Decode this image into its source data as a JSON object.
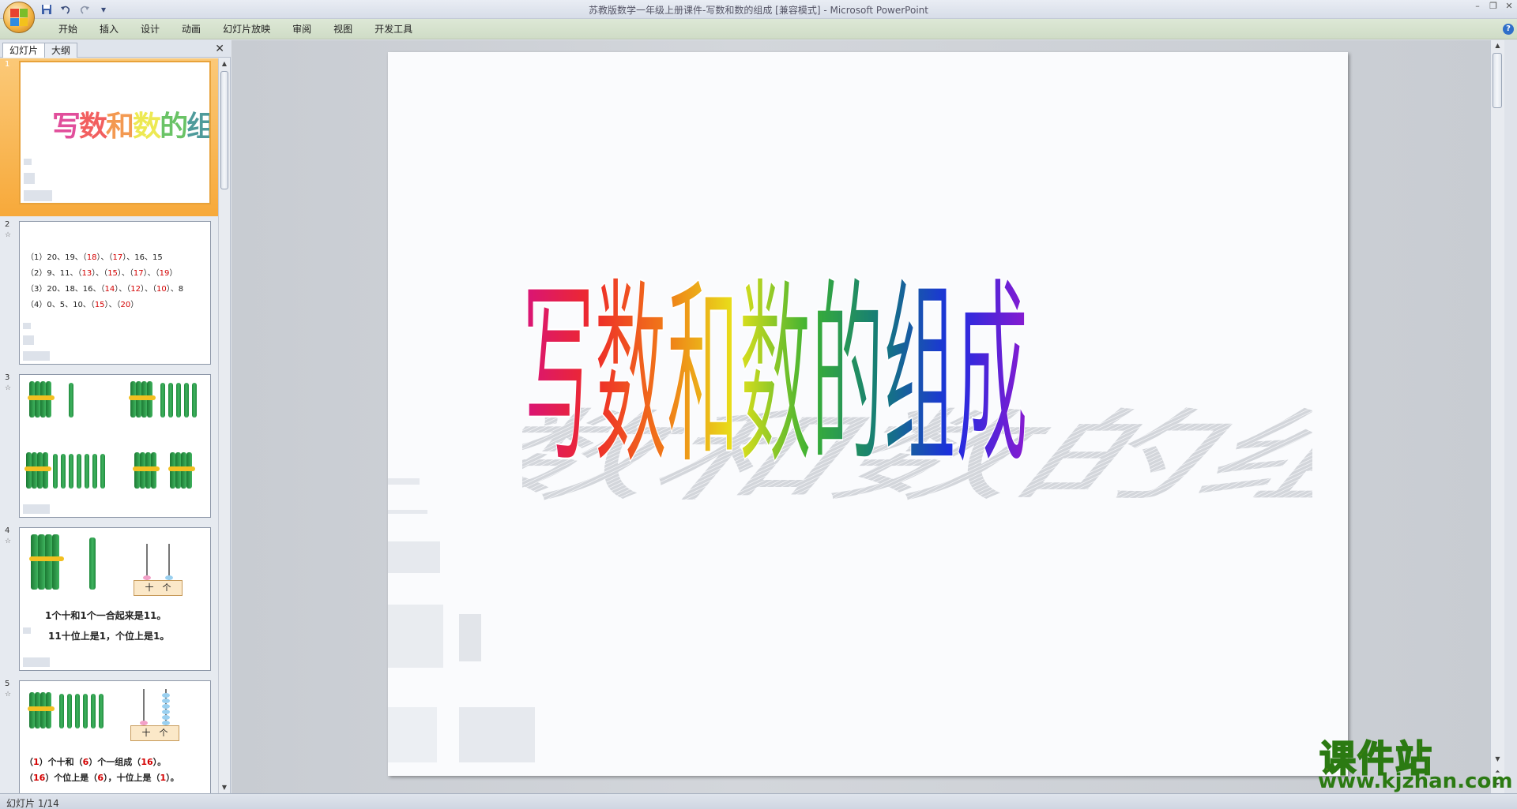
{
  "window": {
    "title": "苏教版数学一年级上册课件-写数和数的组成 [兼容模式] - Microsoft PowerPoint",
    "minimize": "–",
    "restore": "❐",
    "close": "✕"
  },
  "qat": {
    "save_icon": "save-icon",
    "undo_icon": "undo-icon",
    "redo_icon": "redo-icon",
    "customize": "▾"
  },
  "ribbon": {
    "tabs": [
      {
        "label": "开始"
      },
      {
        "label": "插入"
      },
      {
        "label": "设计"
      },
      {
        "label": "动画"
      },
      {
        "label": "幻灯片放映"
      },
      {
        "label": "审阅"
      },
      {
        "label": "视图"
      },
      {
        "label": "开发工具"
      }
    ],
    "help": "?"
  },
  "panel": {
    "tab_slides": "幻灯片",
    "tab_outline": "大纲",
    "close": "✕"
  },
  "thumbnails": [
    {
      "num": "1",
      "title": "写数和数的组成"
    },
    {
      "num": "2",
      "star": "☆",
      "lines": [
        {
          "pre": "（1）20、19、（",
          "a": "18",
          "mid": "）、（",
          "b": "17",
          "post": "）、16、15"
        },
        {
          "pre": "（2）9、11、（",
          "a": "13",
          "mid": "）、（",
          "b": "15",
          "mid2": "）、（",
          "c": "17",
          "mid3": "）、（",
          "d": "19",
          "post": "）"
        },
        {
          "pre": "（3）20、18、16、（",
          "a": "14",
          "mid": "）、（",
          "b": "12",
          "mid2": "）、（",
          "c": "10",
          "post": "）、8"
        },
        {
          "pre": "（4）0、5、10、（",
          "a": "15",
          "mid": "）、（",
          "b": "20",
          "post": "）"
        }
      ]
    },
    {
      "num": "3",
      "star": "☆"
    },
    {
      "num": "4",
      "star": "☆",
      "abacus_tens": "十",
      "abacus_ones": "个",
      "line1": "1个十和1个一合起来是11。",
      "line2": "11十位上是1，个位上是1。"
    },
    {
      "num": "5",
      "star": "☆",
      "abacus_tens": "十",
      "abacus_ones": "个",
      "line1_a": "（",
      "line1_v1": "1",
      "line1_b": "）个十和（",
      "line1_v2": "6",
      "line1_c": "）个一组成（",
      "line1_v3": "16",
      "line1_d": "）。",
      "line2_a": "（",
      "line2_v1": "16",
      "line2_b": "）个位上是（",
      "line2_v2": "6",
      "line2_c": "），十位上是（",
      "line2_v3": "1",
      "line2_d": "）。"
    }
  ],
  "slide": {
    "title": "写数和数的组成",
    "title_chars": [
      "写",
      "数",
      "和",
      "数",
      "的",
      "组",
      "成"
    ],
    "title_colors": [
      "#d8137a",
      "#ee2a2a",
      "#f07818",
      "#e8e21a",
      "#39b034",
      "#147a7a",
      "#1c2ee0",
      "#8a1ad0"
    ]
  },
  "status": {
    "text": "幻灯片 1/14"
  },
  "watermark": {
    "cn": "课件站",
    "url": "www.kjzhan.com"
  }
}
